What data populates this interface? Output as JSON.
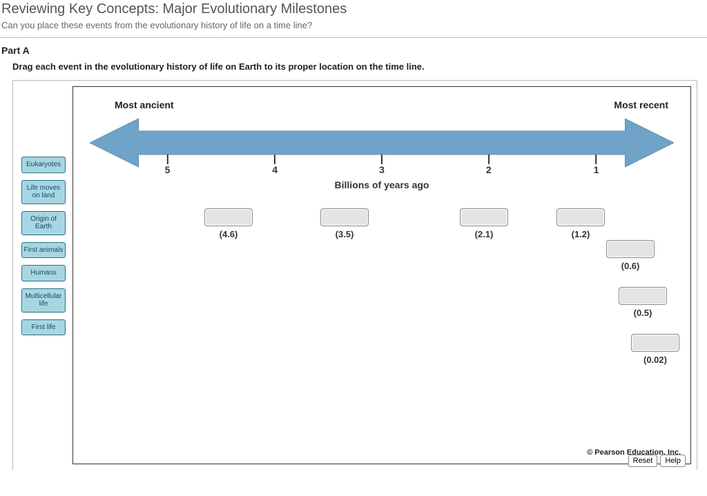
{
  "header": {
    "title": "Reviewing Key Concepts: Major Evolutionary Milestones",
    "subtitle": "Can you place these events from the evolutionary history of life on a time line?"
  },
  "part": {
    "label": "Part A",
    "instruction": "Drag each event in the evolutionary history of life on Earth to its proper location on the time line."
  },
  "timeline": {
    "left_label": "Most ancient",
    "right_label": "Most recent",
    "axis_title": "Billions of years ago",
    "ticks": [
      "5",
      "4",
      "3",
      "2",
      "1"
    ]
  },
  "drag_items": [
    "Eukaryotes",
    "Life moves on land",
    "Origin of Earth",
    "First animals",
    "Humans",
    "Multicellular life",
    "First life"
  ],
  "drop_targets": [
    {
      "value": "(4.6)"
    },
    {
      "value": "(3.5)"
    },
    {
      "value": "(2.1)"
    },
    {
      "value": "(1.2)"
    },
    {
      "value": "(0.6)"
    },
    {
      "value": "(0.5)"
    },
    {
      "value": "(0.02)"
    }
  ],
  "copyright": "© Pearson Education, Inc.",
  "buttons": {
    "reset": "Reset",
    "help": "Help"
  },
  "colors": {
    "arrow": "#6fa3c7",
    "chip_bg": "#a7d6e2",
    "chip_border": "#2a6f87"
  },
  "chart_data": {
    "type": "timeline",
    "axis": "Billions of years ago",
    "axis_direction": "right_to_left_decreasing",
    "range": [
      5,
      0
    ],
    "ticks": [
      5,
      4,
      3,
      2,
      1
    ],
    "markers": [
      4.6,
      3.5,
      2.1,
      1.2,
      0.6,
      0.5,
      0.02
    ],
    "draggable_events": [
      "Eukaryotes",
      "Life moves on land",
      "Origin of Earth",
      "First animals",
      "Humans",
      "Multicellular life",
      "First life"
    ],
    "endpoints": {
      "left": "Most ancient",
      "right": "Most recent"
    }
  }
}
